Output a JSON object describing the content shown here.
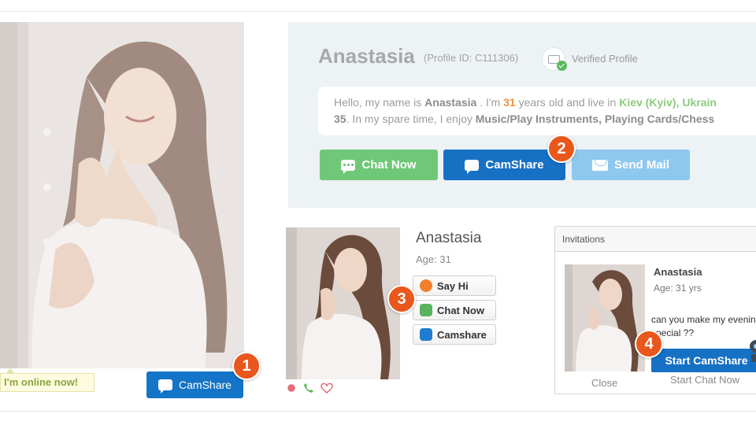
{
  "main": {
    "online_text": "I'm online now!",
    "camshare_label": "CamShare"
  },
  "badges": [
    "1",
    "2",
    "3",
    "4"
  ],
  "profile": {
    "name": "Anastasia",
    "profile_id": "(Profile ID: C111306)",
    "verified": "Verified Profile",
    "bio": {
      "l1_a": "Hello, my name is ",
      "l1_name": "Anastasia",
      "l1_b": " . I'm ",
      "l1_age": "31",
      "l1_c": " years old and live in ",
      "l1_city": "Kiev (Kyiv), Ukrain",
      "l2_num": "35",
      "l2_a": ". In my spare time, I enjoy ",
      "l2_hobbies": "Music/Play Instruments, Playing Cards/Chess"
    },
    "buttons": {
      "chat": "Chat Now",
      "camshare": "CamShare",
      "mail": "Send Mail"
    }
  },
  "small_profile": {
    "name": "Anastasia",
    "age": "Age: 31",
    "buttons": {
      "say_hi": "Say Hi",
      "chat": "Chat Now",
      "camshare": "Camshare"
    }
  },
  "invitation": {
    "header": "Invitations",
    "name": "Anastasia",
    "age": "Age: 31 yrs",
    "message": "can you make my evening special ??",
    "start_label": "Start CamShare",
    "close_label": "Close",
    "chat_label": "Start Chat Now"
  },
  "colors": {
    "badge": "#e9571c",
    "camshare_blue": "#1671c5",
    "chat_green": "#6fc877",
    "mail_blue": "#8ec8ee"
  }
}
